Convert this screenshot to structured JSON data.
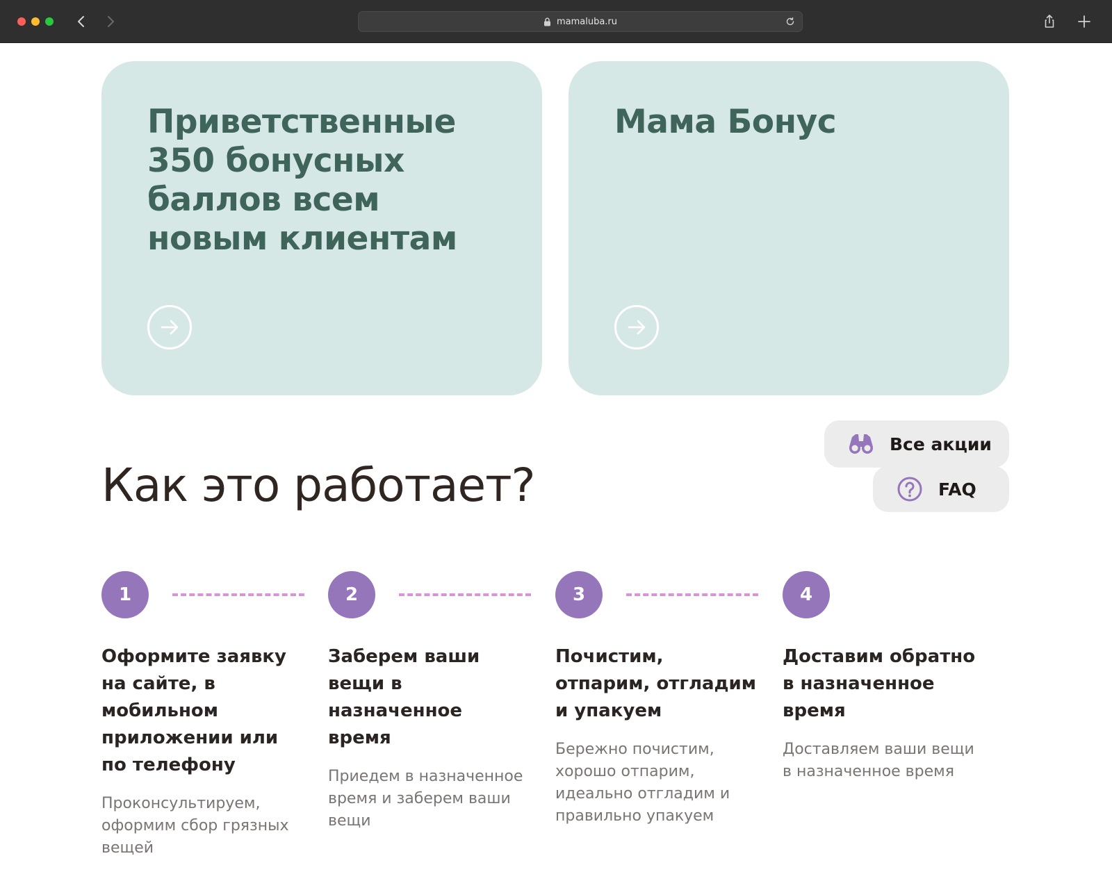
{
  "browser": {
    "url": "mamaluba.ru"
  },
  "promos": [
    {
      "title": "Приветственные 350 бонусных баллов всем новым клиентам"
    },
    {
      "title": "Мама Бонус"
    }
  ],
  "section": {
    "title": "Как это работает?"
  },
  "buttons": {
    "all_promos": "Все акции",
    "faq": "FAQ"
  },
  "steps": [
    {
      "number": "1",
      "title": "Оформите заявку на сайте, в мобильном приложении или по телефону",
      "desc": "Проконсультируем, оформим сбор грязных вещей"
    },
    {
      "number": "2",
      "title": "Заберем ваши вещи в назначенное время",
      "desc": "Приедем в назначенное время и заберем ваши вещи"
    },
    {
      "number": "3",
      "title": "Почистим, отпарим, отгладим и упакуем",
      "desc": "Бережно почистим, хорошо отпарим, идеально отгладим и правильно упакуем"
    },
    {
      "number": "4",
      "title": "Доставим обратно в назначенное время",
      "desc": "Доставляем ваши вещи в назначенное время"
    }
  ],
  "colors": {
    "card_bg": "#d6e8e5",
    "card_text": "#3f6459",
    "step_circle": "#9676bb",
    "dash": "#d595d6",
    "icon_accent": "#9676bb"
  }
}
